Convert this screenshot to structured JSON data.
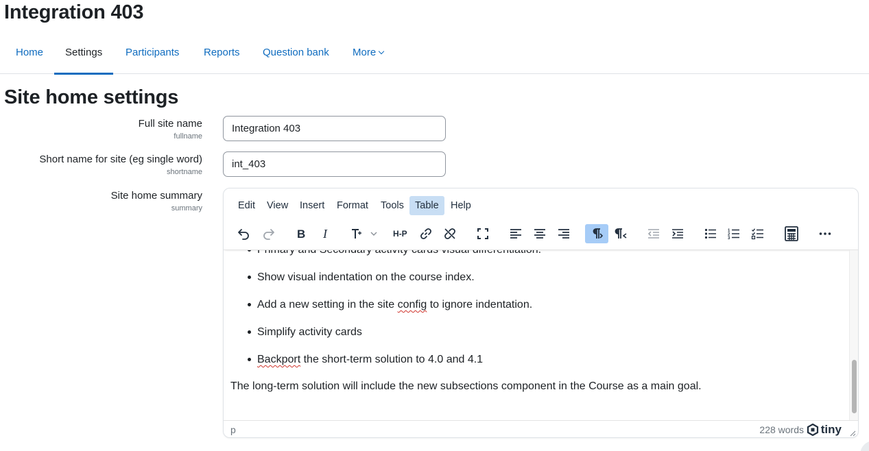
{
  "site": {
    "title": "Integration 403"
  },
  "nav": {
    "tabs": [
      {
        "label": "Home"
      },
      {
        "label": "Settings"
      },
      {
        "label": "Participants"
      },
      {
        "label": "Reports"
      },
      {
        "label": "Question bank"
      },
      {
        "label": "More"
      }
    ]
  },
  "page": {
    "heading": "Site home settings"
  },
  "form": {
    "fullname": {
      "label": "Full site name",
      "sub": "fullname",
      "value": "Integration 403"
    },
    "shortname": {
      "label": "Short name for site (eg single word)",
      "sub": "shortname",
      "value": "int_403"
    },
    "summary": {
      "label": "Site home summary",
      "sub": "summary"
    }
  },
  "editor": {
    "menu": [
      "Edit",
      "View",
      "Insert",
      "Format",
      "Tools",
      "Table",
      "Help"
    ],
    "active_menu": "Table",
    "toolbar_icons": [
      "undo-icon",
      "redo-icon",
      "bold-icon",
      "italic-icon",
      "font-size-icon",
      "h5p-icon",
      "link-icon",
      "unlink-icon",
      "fullscreen-icon",
      "align-left-icon",
      "align-center-icon",
      "align-right-icon",
      "ltr-icon",
      "rtl-icon",
      "outdent-icon",
      "indent-icon",
      "bullet-list-icon",
      "numbered-list-icon",
      "checklist-icon",
      "calculator-icon",
      "more-icon"
    ],
    "content": {
      "list_items": [
        "Primary and Secondary activity cards visual differentiation.",
        "Show visual indentation on the course index.",
        "Add a new setting in the site ",
        "Simplify activity cards",
        "the short-term solution to 4.0 and 4.1"
      ],
      "li3_squiggle": "config",
      "li3_tail": " to ignore indentation.",
      "li5_squiggle": "Backport",
      "paragraph": "The long-term solution will include the new subsections component in the Course as a main goal."
    },
    "status": {
      "path": "p",
      "words": "228 words",
      "brand": "tiny"
    }
  },
  "colors": {
    "link": "#0f6cbf",
    "active_bg": "#c8def4",
    "toggle_bg": "#a6ccf7"
  }
}
